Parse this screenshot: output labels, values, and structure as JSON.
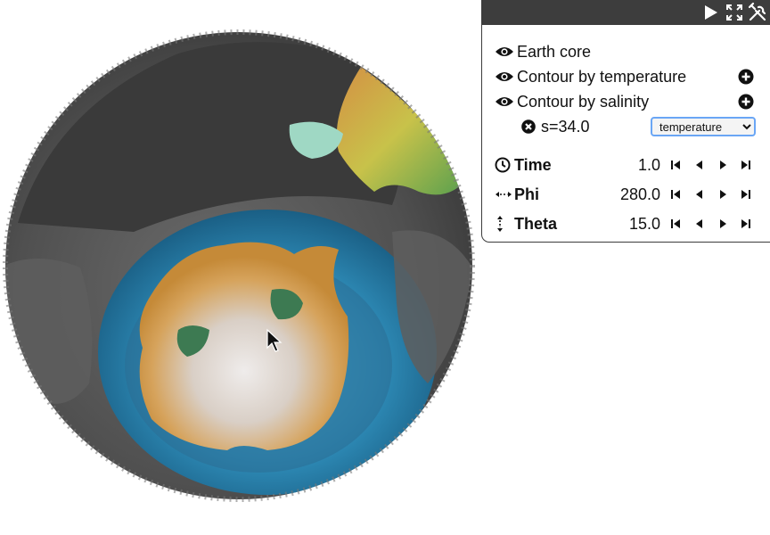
{
  "toolbar": {
    "play_icon": "play-icon",
    "fullscreen_icon": "fullscreen-icon",
    "settings_icon": "tools-icon"
  },
  "layers": [
    {
      "label": "Earth core",
      "icon": "eye-icon",
      "has_add": false
    },
    {
      "label": "Contour by temperature",
      "icon": "eye-icon",
      "has_add": true
    },
    {
      "label": "Contour by salinity",
      "icon": "eye-icon",
      "has_add": true
    }
  ],
  "contour_item": {
    "label": "s=34.0",
    "remove_icon": "close-circle-icon",
    "select": {
      "selected": "temperature",
      "options": [
        "temperature"
      ]
    }
  },
  "params": [
    {
      "label": "Time",
      "value": "1.0",
      "icon": "clock-icon"
    },
    {
      "label": "Phi",
      "value": "280.0",
      "icon": "horizontal-arrows-icon"
    },
    {
      "label": "Theta",
      "value": "15.0",
      "icon": "vertical-arrows-icon"
    }
  ],
  "colors": {
    "panel_bar": "#3d3d3d",
    "ocean_blue": "#2a7fa8",
    "land_orange": "#c9883c",
    "ice_white": "#e6e0da",
    "rock_gray": "#5a5a5a"
  }
}
